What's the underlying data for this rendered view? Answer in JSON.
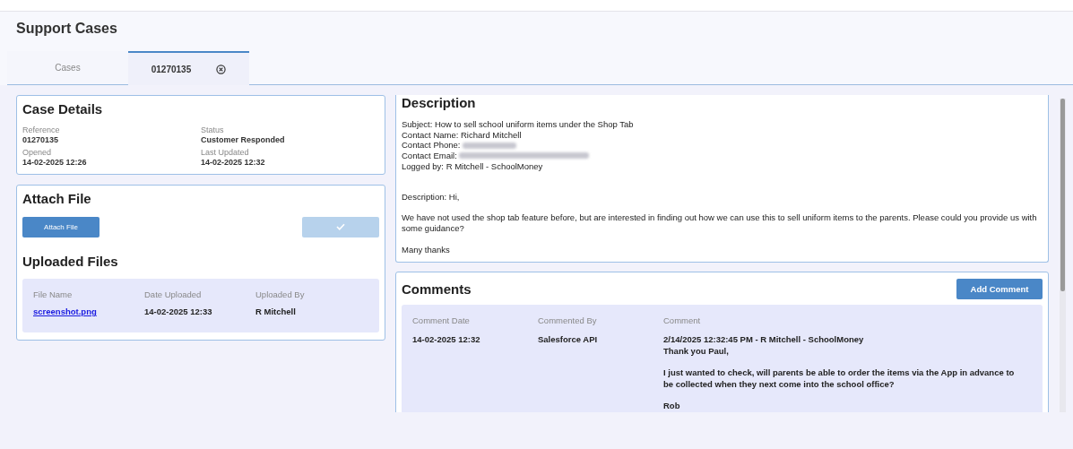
{
  "page": {
    "title": "Support Cases"
  },
  "tabs": [
    {
      "label": "Cases",
      "selected": false,
      "closable": false
    },
    {
      "label": "01270135",
      "selected": true,
      "closable": true
    }
  ],
  "case_details": {
    "title": "Case Details",
    "fields": [
      {
        "label": "Reference",
        "value": "01270135"
      },
      {
        "label": "Status",
        "value": "Customer Responded"
      },
      {
        "label": "Opened",
        "value": "14-02-2025 12:26"
      },
      {
        "label": "Last Updated",
        "value": "14-02-2025 12:32"
      }
    ]
  },
  "attach_file": {
    "title": "Attach File",
    "attach_button": "Attach File",
    "confirm_disabled": true,
    "uploaded_title": "Uploaded Files",
    "columns": [
      "File Name",
      "Date Uploaded",
      "Uploaded By"
    ],
    "rows": [
      {
        "file": "screenshot.png",
        "date": "14-02-2025 12:33",
        "by": "R Mitchell"
      }
    ]
  },
  "description": {
    "title": "Description",
    "lines": [
      {
        "text": "Subject: How to sell school uniform items under the Shop Tab"
      },
      {
        "text": "Contact Name: Richard Mitchell"
      },
      {
        "text": "Contact Phone:",
        "redacted": true
      },
      {
        "text": "Contact Email:",
        "redacted": true
      },
      {
        "text": "Logged by: R Mitchell - SchoolMoney"
      }
    ],
    "paragraphs": [
      "Description: Hi,",
      "We have not used the shop tab feature before, but are interested in finding out how we can use this to sell uniform items to the parents. Please could you provide us with some guidance?",
      "Many thanks"
    ]
  },
  "comments": {
    "title": "Comments",
    "add_button": "Add Comment",
    "columns": [
      "Comment Date",
      "Commented By",
      "Comment"
    ],
    "rows": [
      {
        "date": "14-02-2025 12:32",
        "by": "Salesforce API",
        "paragraphs": [
          [
            "2/14/2025 12:32:45 PM - R Mitchell - SchoolMoney",
            "Thank you Paul,"
          ],
          [
            "I just wanted to check, will parents be able to order the items via the App in advance to be collected when they next come into the school office?"
          ],
          [
            "Rob"
          ]
        ]
      }
    ]
  }
}
